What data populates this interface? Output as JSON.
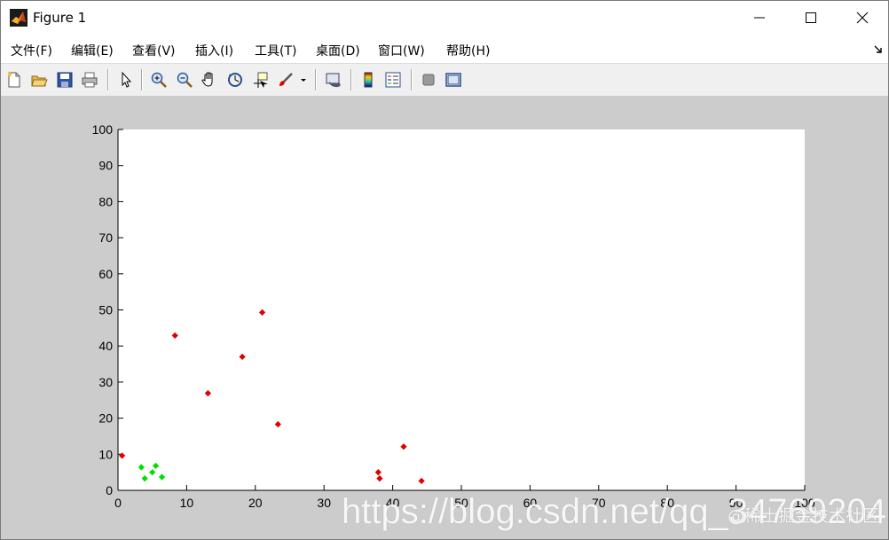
{
  "window": {
    "title": "Figure 1",
    "controls": {
      "minimize": "minimize",
      "maximize": "maximize",
      "close": "close"
    }
  },
  "menu": {
    "items": [
      {
        "label": "文件(F)"
      },
      {
        "label": "编辑(E)"
      },
      {
        "label": "查看(V)"
      },
      {
        "label": "插入(I)"
      },
      {
        "label": "工具(T)"
      },
      {
        "label": "桌面(D)"
      },
      {
        "label": "窗口(W)"
      },
      {
        "label": "帮助(H)"
      }
    ]
  },
  "toolbar": {
    "icons": [
      "new-figure-icon",
      "open-file-icon",
      "save-icon",
      "print-icon",
      "pointer-icon",
      "zoom-in-icon",
      "zoom-out-icon",
      "pan-hand-icon",
      "rotate-3d-icon",
      "data-cursor-icon",
      "brush-icon",
      "link-plot-icon",
      "colorbar-icon",
      "legend-icon",
      "hide-plot-tools-icon",
      "show-plot-tools-icon"
    ]
  },
  "chart_data": {
    "type": "scatter",
    "title": "",
    "xlabel": "",
    "ylabel": "",
    "xlim": [
      0,
      100
    ],
    "ylim": [
      0,
      100
    ],
    "xticks": [
      0,
      10,
      20,
      30,
      40,
      50,
      60,
      70,
      80,
      90,
      100
    ],
    "yticks": [
      0,
      10,
      20,
      30,
      40,
      50,
      60,
      70,
      80,
      90,
      100
    ],
    "xtick_labels": [
      "0",
      "10",
      "20",
      "30",
      "40",
      "50",
      "60",
      "70",
      "80",
      "90",
      "100"
    ],
    "ytick_labels": [
      "0",
      "10",
      "20",
      "30",
      "40",
      "50",
      "60",
      "70",
      "80",
      "90",
      "100"
    ],
    "grid": false,
    "series": [
      {
        "color": "#e00000",
        "marker": "diamond",
        "points": [
          {
            "x": 0.6,
            "y": 9.6
          },
          {
            "x": 8.3,
            "y": 42.9
          },
          {
            "x": 13.1,
            "y": 26.9
          },
          {
            "x": 18.1,
            "y": 37.0
          },
          {
            "x": 21.0,
            "y": 49.3
          },
          {
            "x": 23.3,
            "y": 18.3
          },
          {
            "x": 37.9,
            "y": 5.0
          },
          {
            "x": 38.1,
            "y": 3.3
          },
          {
            "x": 41.6,
            "y": 12.1
          },
          {
            "x": 44.2,
            "y": 2.6
          }
        ]
      },
      {
        "color": "#00e000",
        "marker": "diamond",
        "points": [
          {
            "x": 3.4,
            "y": 6.4
          },
          {
            "x": 3.9,
            "y": 3.3
          },
          {
            "x": 5.0,
            "y": 5.0
          },
          {
            "x": 5.5,
            "y": 6.8
          },
          {
            "x": 6.4,
            "y": 3.7
          }
        ]
      }
    ]
  },
  "watermark": {
    "url_text": "https://blog.csdn.net/qq_34769204",
    "site_text": "@稀土掘金技术社区"
  },
  "colors": {
    "plot_background": "#ffffff",
    "figure_background": "#cccccc",
    "toolbar_background": "#f0f0f0"
  }
}
